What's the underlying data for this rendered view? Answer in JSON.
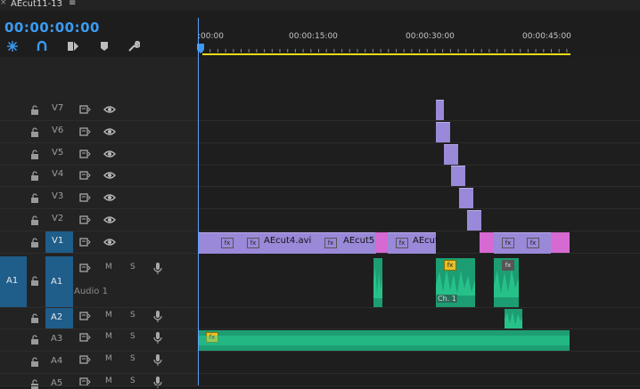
{
  "panel": {
    "close_glyph": "×",
    "title": "AEcut11-13",
    "menu_glyph": "≡"
  },
  "timecode": "00:00:00:00",
  "toolbar": {
    "icons": [
      "snap-settings-icon",
      "magnet-icon",
      "linked-selection-icon",
      "add-marker-icon",
      "wrench-icon"
    ]
  },
  "ruler": {
    "labels": [
      ":00:00",
      "00:00:15:00",
      "00:00:30:00",
      "00:00:45:00"
    ]
  },
  "video_tracks": [
    {
      "name": "V7"
    },
    {
      "name": "V6"
    },
    {
      "name": "V5"
    },
    {
      "name": "V4"
    },
    {
      "name": "V3"
    },
    {
      "name": "V2"
    },
    {
      "name": "V1",
      "source_patch": "V1"
    }
  ],
  "audio_tracks": [
    {
      "name": "A1",
      "source_patch": "A1",
      "target_label": "A1",
      "track_name": "Audio 1",
      "mute": "M",
      "solo": "S"
    },
    {
      "name": "A2",
      "mute": "M",
      "solo": "S"
    },
    {
      "name": "A3",
      "mute": "M",
      "solo": "S"
    },
    {
      "name": "A4",
      "mute": "M",
      "solo": "S"
    },
    {
      "name": "A5",
      "mute": "M",
      "solo": "S"
    }
  ],
  "clips": {
    "v1_labels": [
      "AEcut4.avi",
      "AEcut5.",
      "AEcut"
    ],
    "fx": "fx",
    "channel_label": "Ch. 1"
  },
  "colors": {
    "accent": "#3a9bf2",
    "video_clip": "#9a88d8",
    "pink_clip": "#d66ad2",
    "audio_clip": "#1d9d73",
    "work_area": "#e9dd18"
  }
}
